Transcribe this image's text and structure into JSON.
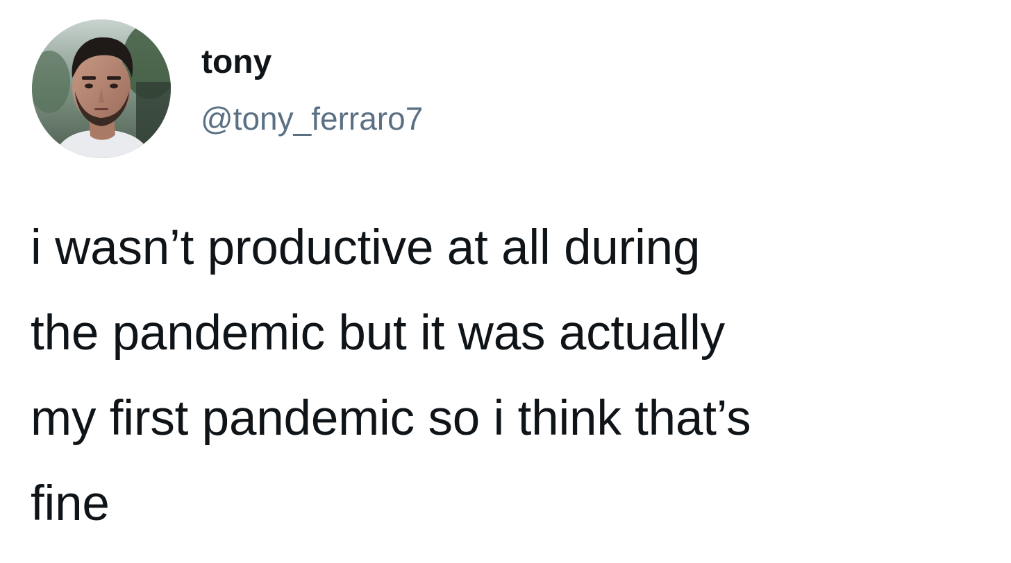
{
  "tweet": {
    "author": {
      "display_name": "tony",
      "handle": "@tony_ferraro7",
      "avatar_icon": "profile-photo"
    },
    "text_lines": [
      "i wasn’t productive at all during",
      "the pandemic but it was actually",
      "my first pandemic so i think that’s",
      "fine"
    ]
  },
  "colors": {
    "background": "#ffffff",
    "name_text": "#0f1419",
    "handle_text": "#5b7083",
    "body_text": "#0f1419"
  }
}
